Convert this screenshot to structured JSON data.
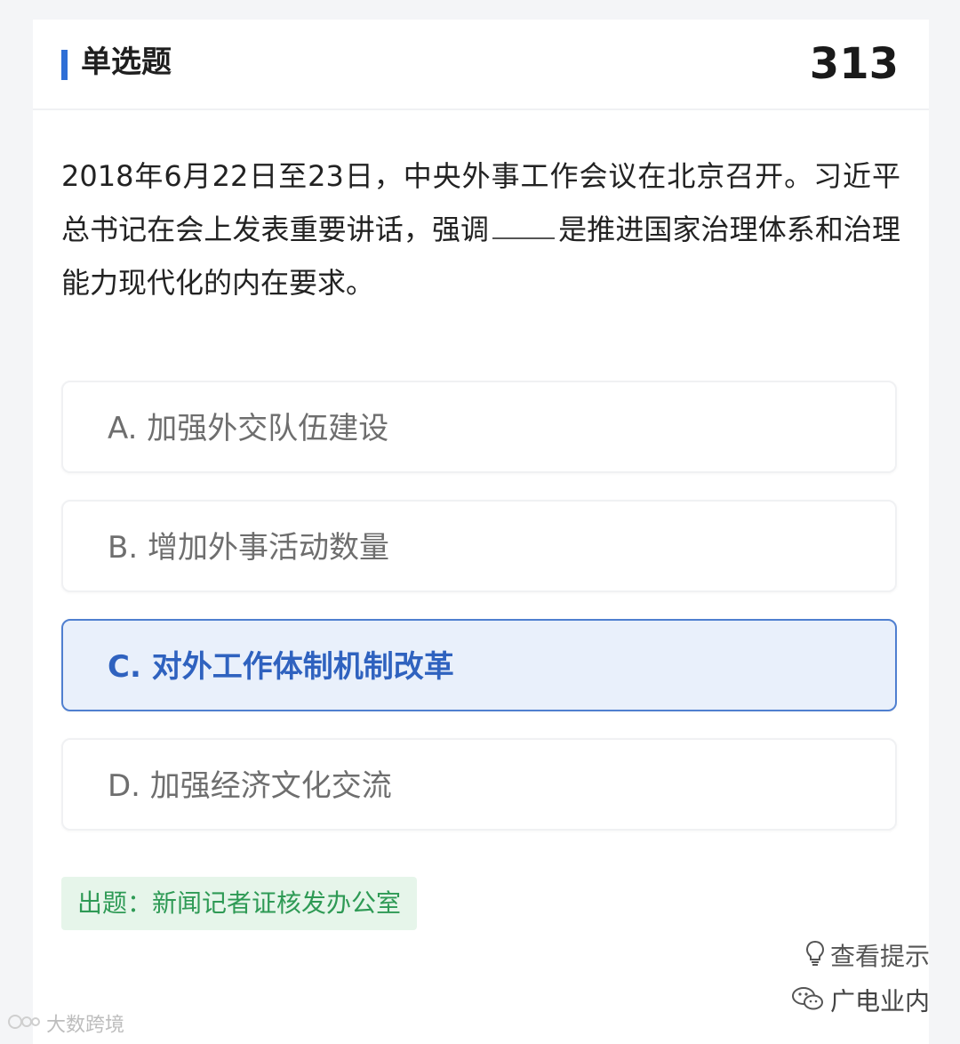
{
  "header": {
    "title": "单选题",
    "question_number": "313",
    "accent_color": "#2f6fd6"
  },
  "question": {
    "text_before_blank": "2018年6月22日至23日，中央外事工作会议在北京召开。习近平总书记在会上发表重要讲话，强调",
    "text_after_blank": "是推进国家治理体系和治理能力现代化的内在要求。"
  },
  "options": [
    {
      "label": "A. 加强外交队伍建设",
      "selected": false
    },
    {
      "label": "B. 增加外事活动数量",
      "selected": false
    },
    {
      "label": "C. 对外工作体制机制改革",
      "selected": true
    },
    {
      "label": "D. 加强经济文化交流",
      "selected": false
    }
  ],
  "source": {
    "text": "出题：新闻记者证核发办公室",
    "color": "#2e9a55"
  },
  "hint": {
    "label": "查看提示",
    "icon": "lightbulb-icon"
  },
  "watermarks": {
    "left": "大数跨境",
    "right": "广电业内",
    "right_icon": "wechat-icon"
  },
  "colors": {
    "selected_bg": "#e9f0fb",
    "selected_border": "#4f7fd0",
    "selected_text": "#2f62bf"
  }
}
